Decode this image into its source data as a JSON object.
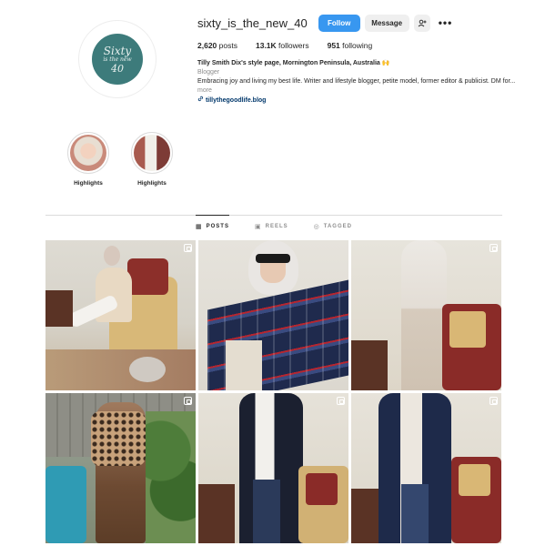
{
  "profile": {
    "username": "sixty_is_the_new_40",
    "avatar_text": [
      "Sixty",
      "is the new",
      "40"
    ],
    "follow_label": "Follow",
    "message_label": "Message",
    "add_person_icon": "add-person-icon",
    "more_icon": "•••"
  },
  "stats": {
    "posts_count": "2,620",
    "posts_label": "posts",
    "followers_count": "13.1K",
    "followers_label": "followers",
    "following_count": "951",
    "following_label": "following"
  },
  "bio": {
    "name": "Tilly Smith Dix's style page, Mornington Peninsula, Australia",
    "name_emoji": "🙌",
    "category": "Blogger",
    "text": "Embracing joy and living my best life. Writer and lifestyle blogger, petite model, former editor & publicist. DM for...",
    "more": "more",
    "link": "tillythegoodlife.blog"
  },
  "highlights": [
    {
      "label": "Highlights"
    },
    {
      "label": "Highlights"
    }
  ],
  "tabs": [
    {
      "label": "POSTS",
      "icon": "grid-icon",
      "glyph": "▦"
    },
    {
      "label": "REELS",
      "icon": "reels-icon",
      "glyph": "▣"
    },
    {
      "label": "TAGGED",
      "icon": "tagged-icon",
      "glyph": "◎"
    }
  ],
  "colors": {
    "follow_blue": "#3897f0",
    "link_blue": "#00376b",
    "avatar_teal": "#3d7b7b"
  }
}
